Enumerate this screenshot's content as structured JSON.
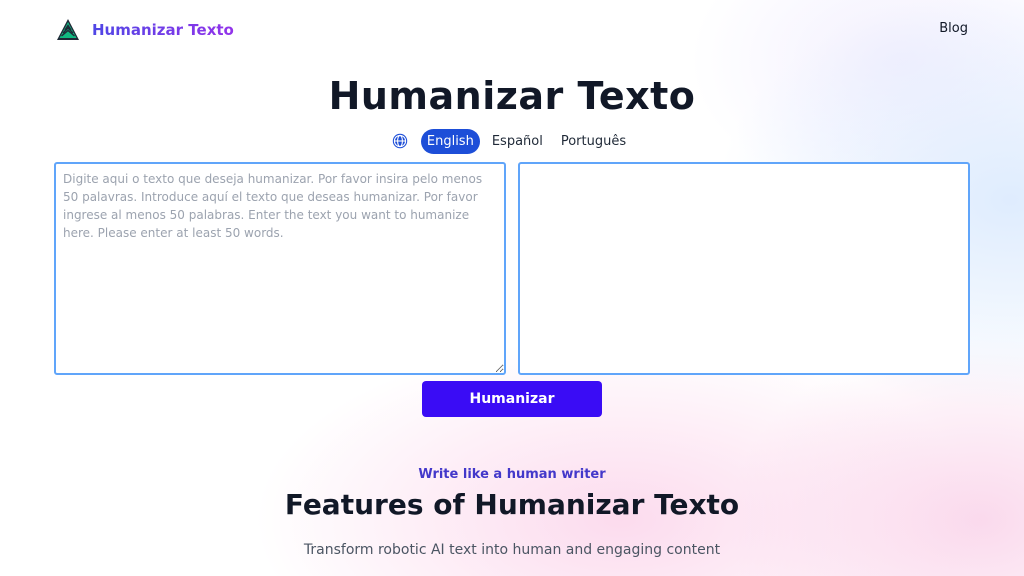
{
  "nav": {
    "brand_name": "Humanizar Texto",
    "logo_icon": "pine-tree-icon",
    "blog_label": "Blog"
  },
  "hero": {
    "title": "Humanizar Texto"
  },
  "languages": {
    "icon": "globe-icon",
    "items": [
      {
        "label": "English",
        "active": true
      },
      {
        "label": "Español",
        "active": false
      },
      {
        "label": "Português",
        "active": false
      }
    ]
  },
  "editor": {
    "input_placeholder": "Digite aqui o texto que deseja humanizar. Por favor insira pelo menos 50 palavras. Introduce aquí el texto que deseas humanizar. Por favor ingrese al menos 50 palabras. Enter the text you want to humanize here. Please enter at least 50 words.",
    "input_value": "",
    "output_value": ""
  },
  "actions": {
    "humanize_label": "Humanizar"
  },
  "features": {
    "eyebrow": "Write like a human writer",
    "title": "Features of Humanizar Texto",
    "subtitle": "Transform robotic AI text into human and engaging content"
  },
  "colors": {
    "accent": "#3a0cf5",
    "active_lang": "#1d4ed8",
    "editor_border": "#60a5fa",
    "brand_gradient_start": "#4f46e5",
    "brand_gradient_end": "#9333ea"
  }
}
